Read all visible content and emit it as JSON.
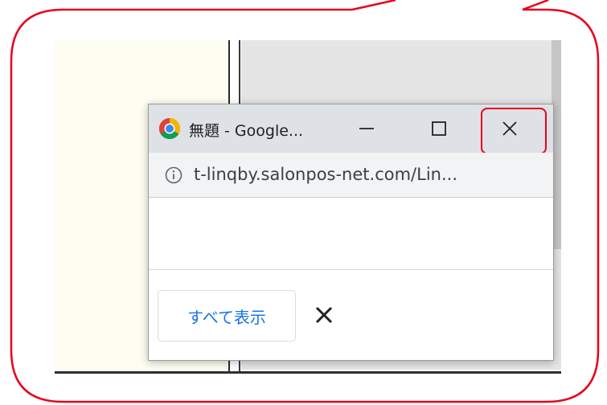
{
  "window": {
    "title": "無題 - Google...",
    "url": "t-linqby.salonpos-net.com/Lin...",
    "icons": {
      "app": "chrome-logo-icon",
      "minimize": "minimize-icon",
      "maximize": "maximize-icon",
      "close": "close-icon",
      "site_info": "info-icon"
    }
  },
  "download_bar": {
    "show_all_label": "すべて表示",
    "close_icon": "close-icon"
  },
  "annotation": {
    "color": "#e8001c"
  }
}
